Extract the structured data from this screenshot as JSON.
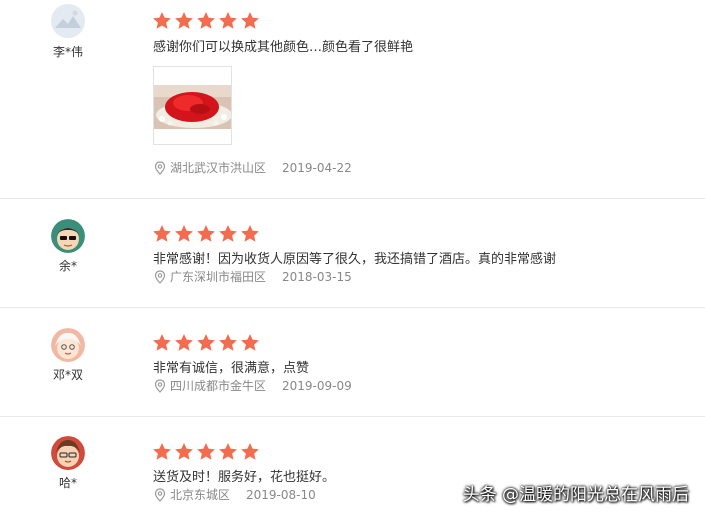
{
  "colors": {
    "star": "#f36c4f",
    "divider": "#e8e8e8",
    "meta_text": "#888888"
  },
  "reviews": [
    {
      "username": "李*伟",
      "rating": 5,
      "comment": "感谢你们可以换成其他颜色…颜色看了很鲜艳",
      "has_photo": true,
      "location": "湖北武汉市洪山区",
      "date": "2019-04-22"
    },
    {
      "username": "余*",
      "rating": 5,
      "comment": "非常感谢！因为收货人原因等了很久，我还搞错了酒店。真的非常感谢",
      "location": "广东深圳市福田区",
      "date": "2018-03-15"
    },
    {
      "username": "邓*双",
      "rating": 5,
      "comment": "非常有诚信，很满意，点赞",
      "location": "四川成都市金牛区",
      "date": "2019-09-09"
    },
    {
      "username": "哈*",
      "rating": 5,
      "comment": "送货及时！服务好，花也挺好。",
      "location": "北京东城区",
      "date": "2019-08-10"
    }
  ],
  "watermark": "头条 @温暖的阳光总在风雨后"
}
